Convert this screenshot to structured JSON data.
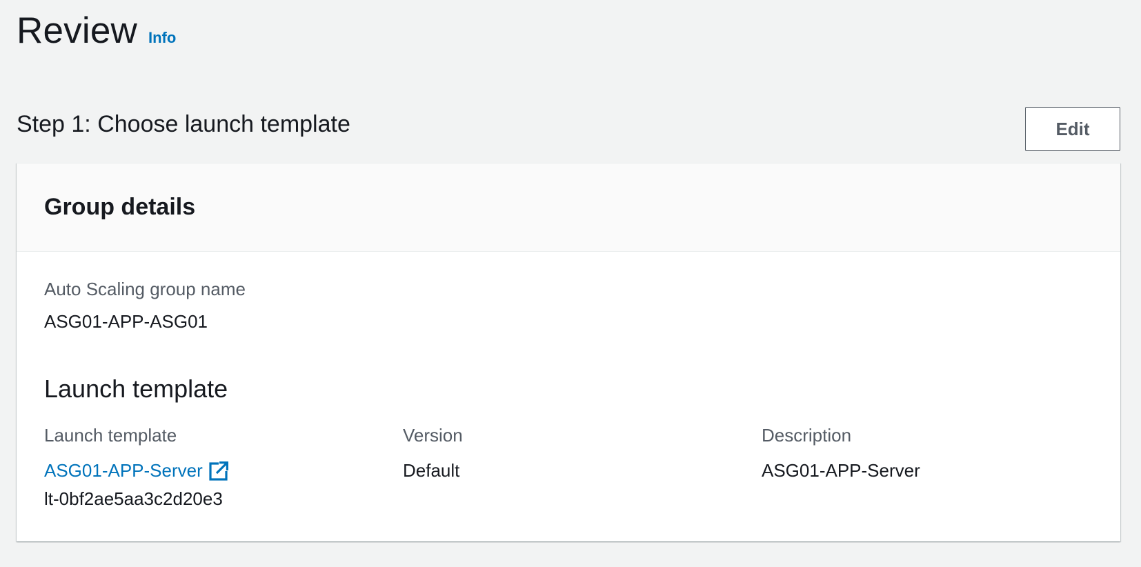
{
  "page": {
    "title": "Review",
    "info_link": "Info"
  },
  "step1": {
    "title": "Step 1: Choose launch template",
    "edit_label": "Edit"
  },
  "group_details": {
    "title": "Group details",
    "asg_name_label": "Auto Scaling group name",
    "asg_name_value": "ASG01-APP-ASG01"
  },
  "launch_template": {
    "section_title": "Launch template",
    "template_label": "Launch template",
    "template_name": "ASG01-APP-Server",
    "template_id": "lt-0bf2ae5aa3c2d20e3",
    "version_label": "Version",
    "version_value": "Default",
    "description_label": "Description",
    "description_value": "ASG01-APP-Server"
  },
  "icons": {
    "external_link": "external-link-icon"
  },
  "colors": {
    "background": "#f2f3f3",
    "link": "#0073bb",
    "text": "#16191f",
    "label": "#545b64"
  }
}
